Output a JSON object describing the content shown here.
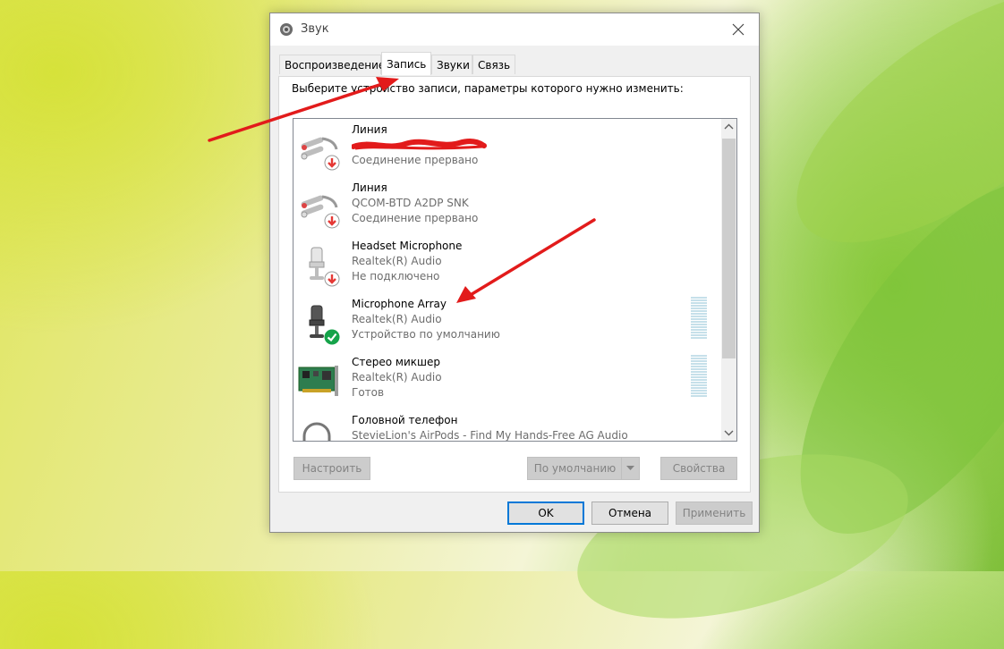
{
  "window": {
    "title": "Звук",
    "close_icon": "close-icon",
    "colors": {
      "accent": "#0078d7",
      "annotation": "#e21b1b",
      "status_ok": "#16a34a",
      "status_error": "#e53935"
    }
  },
  "tabs": [
    {
      "label": "Воспроизведение",
      "active": false
    },
    {
      "label": "Запись",
      "active": true
    },
    {
      "label": "Звуки",
      "active": false
    },
    {
      "label": "Связь",
      "active": false
    }
  ],
  "panel": {
    "instruction": "Выберите устройство записи, параметры которого нужно изменить:"
  },
  "devices": [
    {
      "name": "Линия",
      "driver": "",
      "status": "Соединение прервано",
      "icon": "line-in-icon",
      "badge": "disconnected-badge-icon"
    },
    {
      "name": "Линия",
      "driver": "QCOM-BTD A2DP SNK",
      "status": "Соединение прервано",
      "icon": "line-in-icon",
      "badge": "disconnected-badge-icon"
    },
    {
      "name": "Headset Microphone",
      "driver": "Realtek(R) Audio",
      "status": "Не подключено",
      "icon": "microphone-icon",
      "badge": "disconnected-badge-icon"
    },
    {
      "name": "Microphone Array",
      "driver": "Realtek(R) Audio",
      "status": "Устройство по умолчанию",
      "icon": "microphone-array-icon",
      "badge": "default-check-icon"
    },
    {
      "name": "Стерео микшер",
      "driver": "Realtek(R) Audio",
      "status": "Готов",
      "icon": "sound-card-icon",
      "badge": ""
    },
    {
      "name": "Головной телефон",
      "driver": "StevieLion's AirPods - Find My Hands-Free AG Audio",
      "status": "",
      "icon": "headphones-icon",
      "badge": ""
    }
  ],
  "buttons": {
    "configure": "Настроить",
    "set_default": "По умолчанию",
    "properties": "Свойства",
    "ok": "OK",
    "cancel": "Отмена",
    "apply": "Применить"
  }
}
